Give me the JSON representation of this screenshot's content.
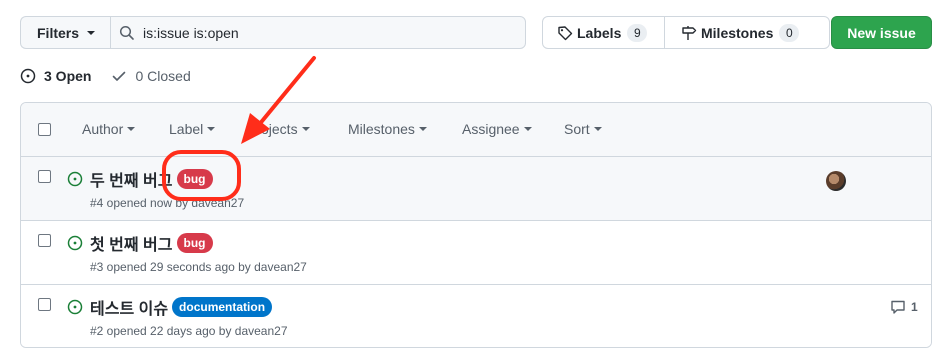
{
  "toolbar": {
    "filters_label": "Filters",
    "search_value": "is:issue is:open",
    "labels_label": "Labels",
    "labels_count": "9",
    "milestones_label": "Milestones",
    "milestones_count": "0",
    "new_issue_label": "New issue"
  },
  "states": {
    "open_label": "3 Open",
    "closed_label": "0 Closed"
  },
  "header_filters": [
    "Author",
    "Label",
    "Projects",
    "Milestones",
    "Assignee",
    "Sort"
  ],
  "issues": [
    {
      "title": "두 번째 버그",
      "label": "bug",
      "meta": "#4 opened now by davean27",
      "has_avatar": true
    },
    {
      "title": "첫 번째 버그",
      "label": "bug",
      "meta": "#3 opened 29 seconds ago by davean27"
    },
    {
      "title": "테스트 이슈",
      "label": "documentation",
      "meta": "#2 opened 22 days ago by davean27",
      "comment_count": "1"
    }
  ],
  "colors": {
    "bug": "#d73a4a",
    "documentation": "#0075ca",
    "open_icon": "#1a7f37",
    "primary_button": "#2da44e",
    "annotation": "#ff2d1a"
  },
  "icons": {
    "search": "search-icon",
    "tag": "tag-icon",
    "milestone": "milestone-icon",
    "issue_open": "issue-opened-icon",
    "check": "check-icon",
    "comment": "comment-icon"
  }
}
